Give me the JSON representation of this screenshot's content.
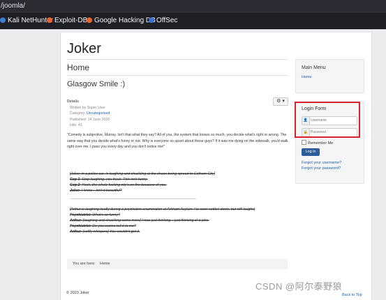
{
  "browser": {
    "url": "/joomla/",
    "bookmarks": [
      {
        "label": "Kali NetHunter",
        "icon": "kali-icon",
        "color": "#3b7fd1"
      },
      {
        "label": "Exploit-DB",
        "icon": "exploit-db-icon",
        "color": "#e8632d"
      },
      {
        "label": "Google Hacking DB",
        "icon": "ghdb-icon",
        "color": "#e8632d"
      },
      {
        "label": "OffSec",
        "icon": "offsec-icon",
        "color": "#3d6fd6"
      }
    ]
  },
  "site": {
    "brand": "Joker",
    "page_title": "Home",
    "article_title": "Glasgow Smile :)",
    "gear_label": "⚙ ▾",
    "details": {
      "heading": "Details",
      "written_by": "Written by Super User",
      "category_label": "Category: ",
      "category_value": "Uncategorised",
      "published": "Published: 14 June 2020",
      "hits": "Hits: 41"
    },
    "intro": "\"Comedy is subjective, Murray. Isn't that what they say? All of you, the system that knows so much, you decide what's right or wrong. The same way that you decide what's funny or not. Why is everyone so upset about these guys? If it was me dying on the sidewalk, you'd walk right over me. I pass you every day and you don't notice me!\"",
    "scene1": {
      "direction": "[Joker, in a police car, is laughing and chuckling at the chaos being spread to Gotham City]",
      "lines": [
        {
          "speaker": "Cop 1",
          "text": ": Stop laughing, you freak. This isn't funny."
        },
        {
          "speaker": "Cop 2",
          "text": ": Yeah, the whole fucking city's on fire because of you."
        },
        {
          "speaker": "Joker",
          "text": ": I know... Isn't it beautiful?"
        }
      ]
    },
    "scene2": {
      "direction": "[Arthur is laughing loudly during a psychiatric examination at Arkham Asylum. He soon settles down, but still laughs]",
      "lines": [
        {
          "speaker": "Psychiatrist",
          "text": ": What's so funny?"
        },
        {
          "speaker": "Arthur",
          "text": ": [laughing and chuckling some more] I was just thinking... just thinking of a joke."
        },
        {
          "speaker": "Psychiatrist",
          "text": ": Do you wanna tell it to me?"
        },
        {
          "speaker": "Arthur",
          "text": ": [softly whispers] You wouldn't get it."
        }
      ]
    },
    "breadcrumb": {
      "label": "You are here:",
      "item": "Home"
    },
    "main_menu": {
      "heading": "Main Menu",
      "item": "Home"
    },
    "login": {
      "heading": "Login Form",
      "username_placeholder": "Username",
      "password_placeholder": "Password",
      "remember_me": "Remember Me",
      "login_button": "Log in",
      "forgot_username": "Forgot your username?",
      "forgot_password": "Forgot your password?"
    },
    "footer": "© 2023 Joker",
    "back_to_top": "Back to Top"
  },
  "watermark": "CSDN @阿尔泰野狼",
  "colors": {
    "highlight": "#d8232a",
    "link": "#1f5ea8",
    "button": "#2a5d9a"
  }
}
